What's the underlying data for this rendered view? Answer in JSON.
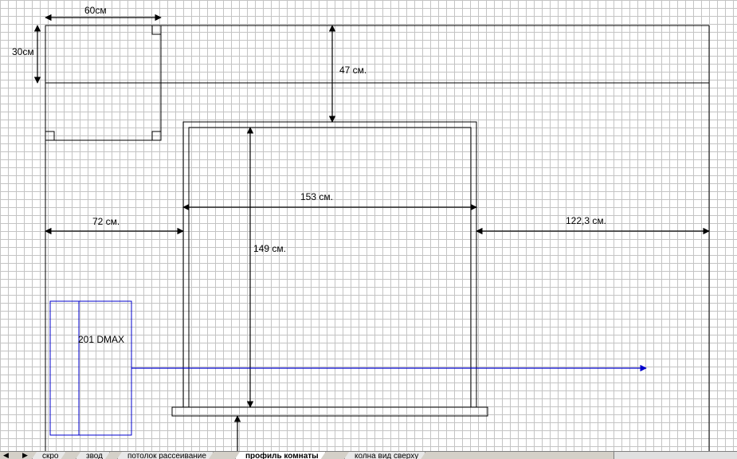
{
  "diagram": {
    "labels": {
      "box_width": "60см",
      "box_height": "30см",
      "gap_top": "47 см.",
      "left_gap": "72 см.",
      "frame_width": "153 см.",
      "right_gap": "122,3 см.",
      "frame_height": "149 см.",
      "device": "201 DMAX"
    },
    "colors": {
      "lines": "#000000",
      "device": "#0000cc",
      "grid": "#c4c4c4"
    }
  },
  "sheet_tabs": {
    "nav": [
      "◀",
      "▶"
    ],
    "tabs": [
      "скро",
      "звод",
      "потолок рассеивание",
      "профиль комнаты",
      "колна вид сверху"
    ],
    "active_index": 3
  }
}
